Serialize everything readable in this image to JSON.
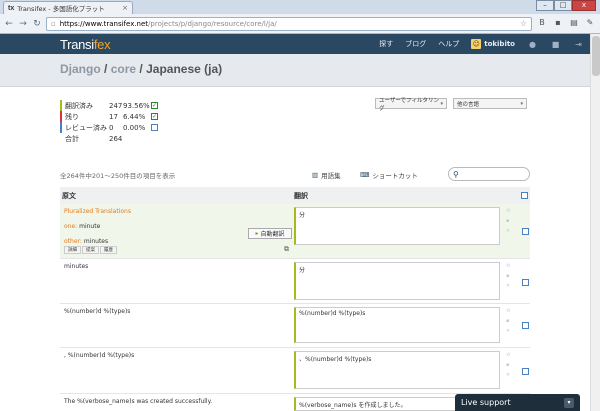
{
  "browser": {
    "tab_favicon": "tx",
    "tab_title": "Transifex - 多国語化プラット",
    "tab_close": "×",
    "url_domain": "https://www.transifex.net",
    "url_path": "/projects/p/django/resource/core/l/ja/",
    "win_min": "–",
    "win_max": "□",
    "win_close": "x"
  },
  "header": {
    "logo_main": "Transi",
    "logo_accent": "fex",
    "nav": [
      "探す",
      "ブログ",
      "ヘルプ"
    ],
    "username": "tokibito"
  },
  "breadcrumb": {
    "project": "Django",
    "resource": "core",
    "language": "Japanese (ja)",
    "sep": "/"
  },
  "stats": {
    "rows": [
      {
        "label": "翻訳済み",
        "count": "247",
        "pct": "93.56%",
        "checked": "✓"
      },
      {
        "label": "残り",
        "count": "17",
        "pct": "6.44%",
        "checked": "✓"
      },
      {
        "label": "レビュー済み",
        "count": "0",
        "pct": "0.00%",
        "checked": ""
      },
      {
        "label": "合計",
        "count": "264",
        "pct": "",
        "checked": ""
      }
    ]
  },
  "filters": {
    "user_filter": "ユーザーでフィルタリング",
    "language_filter": "他の言語"
  },
  "list": {
    "showing": "全264件中201～250件目の項目を表示",
    "glossary": "用語集",
    "shortcuts": "ショートカット",
    "col_source": "原文",
    "col_translation": "翻訳"
  },
  "rows": [
    {
      "plural_title": "Pluralized Translations",
      "one_key": "one:",
      "one_val": "minute",
      "other_key": "other:",
      "other_val": "minutes",
      "mini_tabs": [
        "詳細",
        "提案",
        "履歴"
      ],
      "auto_translate": "自動翻訳",
      "translation": "分"
    },
    {
      "source": "minutes",
      "translation": "分"
    },
    {
      "source": "%(number)d %(type)s",
      "translation": "%(number)d %(type)s"
    },
    {
      "source": ", %(number)d %(type)s",
      "translation": "、%(number)d %(type)s"
    },
    {
      "source": "The %(verbose_name)s was created successfully.",
      "translation": "%(verbose_name)s を作成しました。"
    }
  ],
  "live_support": "Live support"
}
